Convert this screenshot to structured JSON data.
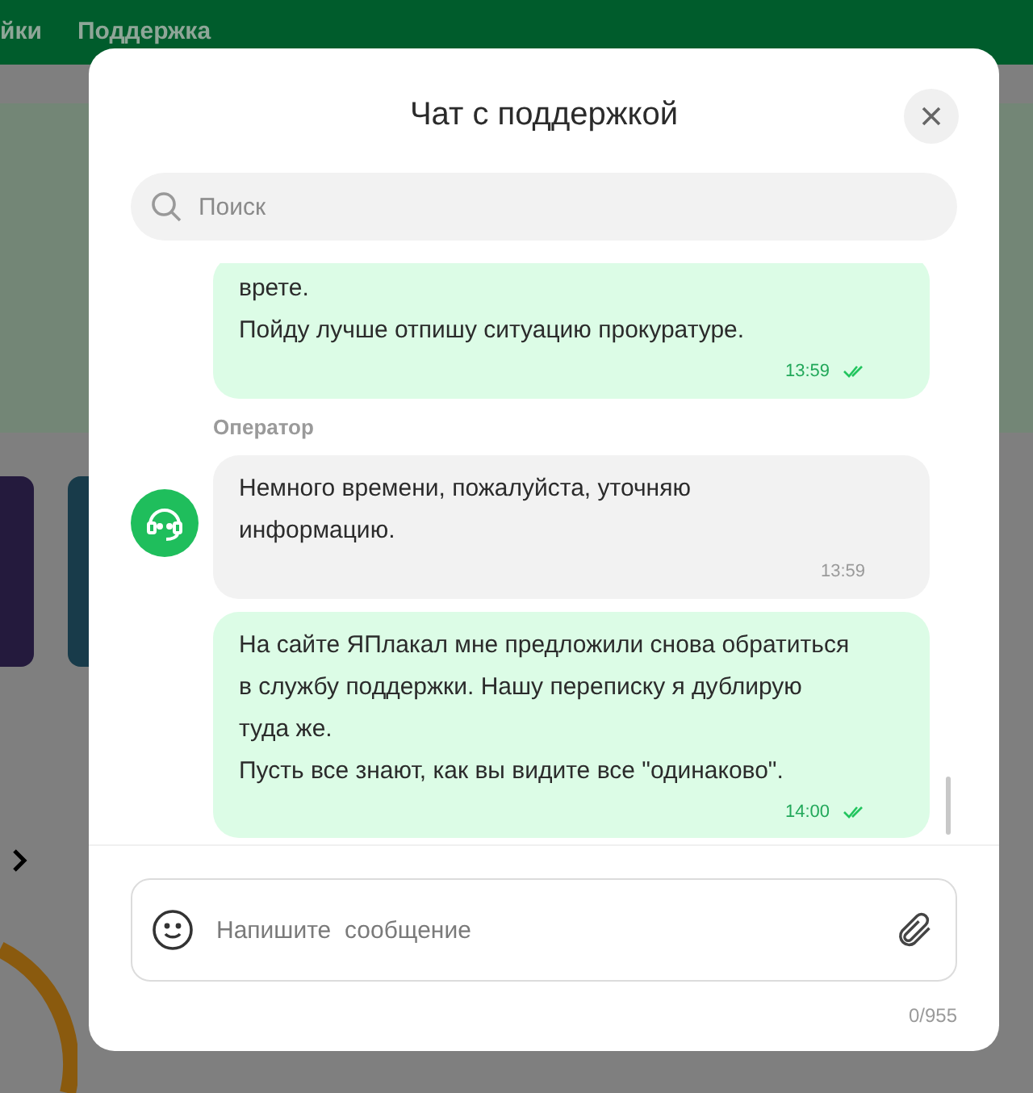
{
  "top_nav": {
    "items": [
      "йки",
      "Поддержка"
    ]
  },
  "dialog": {
    "title": "Чат с поддержкой",
    "search": {
      "placeholder": "Поиск"
    },
    "messages": [
      {
        "kind": "outgoing",
        "paragraphs": [
          "врете.",
          "Пойду лучше отпишу ситуацию прокуратуре."
        ],
        "time": "13:59",
        "read": true
      },
      {
        "kind": "incoming",
        "sender": "Оператор",
        "paragraphs": [
          "Немного времени, пожалуйста, уточняю информацию."
        ],
        "time": "13:59"
      },
      {
        "kind": "outgoing",
        "paragraphs": [
          "На сайте ЯПлакал мне предложили снова обратиться в службу поддержки. Нашу переписку я дублирую туда же.",
          "Пусть все знают, как вы видите все \"одинаково\"."
        ],
        "time": "14:00",
        "read": true
      }
    ],
    "composer": {
      "placeholder": "Напишите  сообщение",
      "counter": "0/955"
    }
  }
}
